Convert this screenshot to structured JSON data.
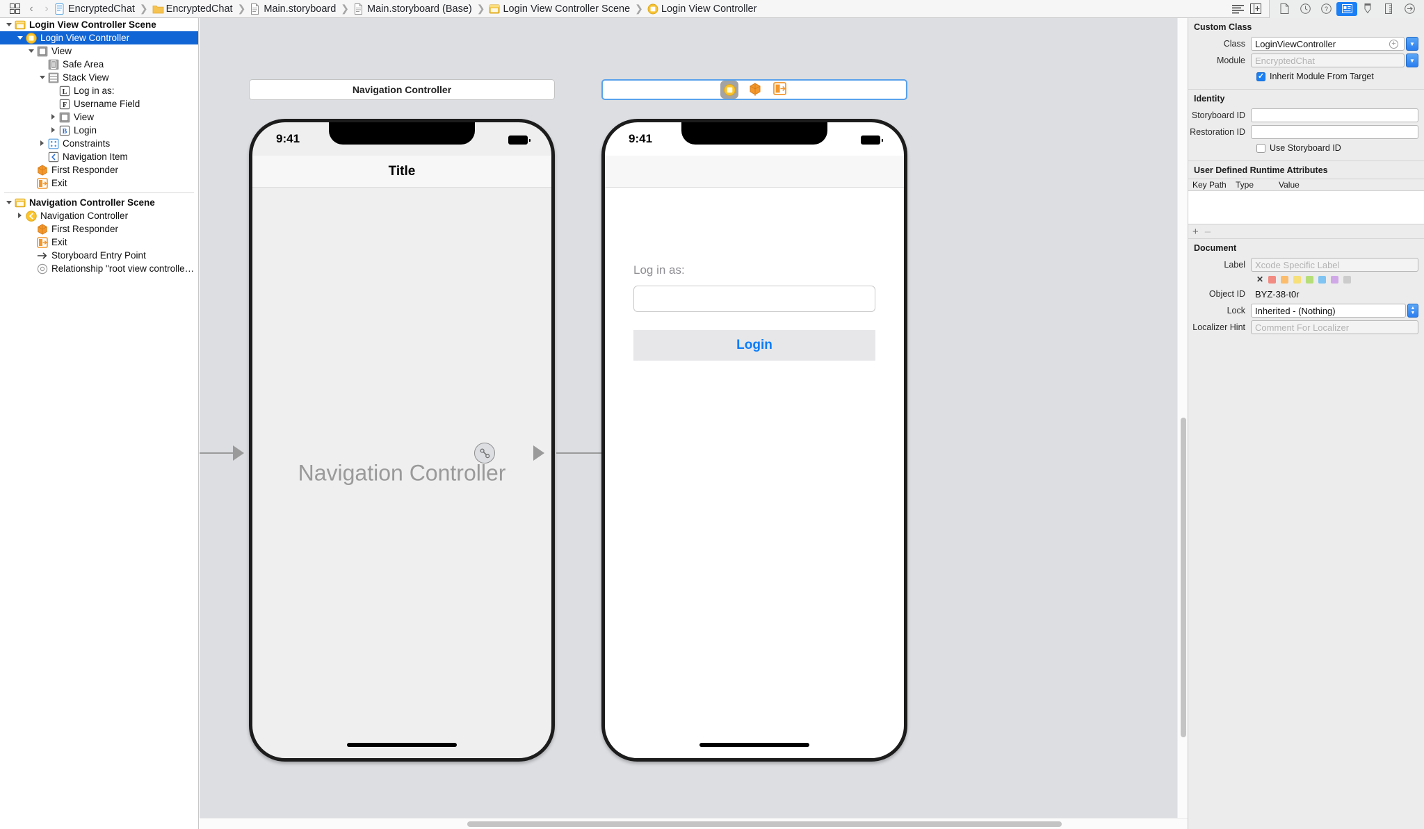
{
  "topbar": {
    "grid_icon": "grid-icon",
    "back_label": "‹",
    "forward_label": "›",
    "breadcrumbs": [
      {
        "label": "EncryptedChat",
        "icon": "project-icon"
      },
      {
        "label": "EncryptedChat",
        "icon": "folder-icon"
      },
      {
        "label": "Main.storyboard",
        "icon": "storyboard-file-icon"
      },
      {
        "label": "Main.storyboard (Base)",
        "icon": "storyboard-file-icon"
      },
      {
        "label": "Login View Controller Scene",
        "icon": "scene-icon"
      },
      {
        "label": "Login View Controller",
        "icon": "view-controller-icon"
      }
    ],
    "editor_buttons": [
      {
        "name": "standard-editor-button"
      },
      {
        "name": "assistant-editor-button"
      }
    ],
    "inspector_buttons": [
      {
        "name": "file-inspector-button",
        "icon": "document-icon",
        "active": false
      },
      {
        "name": "quick-help-inspector-button",
        "icon": "clock-icon",
        "active": false
      },
      {
        "name": "help-inspector-button",
        "icon": "question-icon",
        "active": false
      },
      {
        "name": "identity-inspector-button",
        "icon": "identity-card-icon",
        "active": true
      },
      {
        "name": "attributes-inspector-button",
        "icon": "slider-down-icon",
        "active": false
      },
      {
        "name": "size-inspector-button",
        "icon": "ruler-icon",
        "active": false
      },
      {
        "name": "connections-inspector-button",
        "icon": "arrow-circle-icon",
        "active": false
      }
    ]
  },
  "outline": {
    "groups": [
      {
        "name": "login-view-controller-scene",
        "rows": [
          {
            "label": "Login View Controller Scene",
            "indent": 0,
            "twisty": "open",
            "icon": "scene-icon",
            "bold": true,
            "selected": false
          },
          {
            "label": "Login View Controller",
            "indent": 1,
            "twisty": "open",
            "icon": "view-controller-icon",
            "bold": false,
            "selected": true
          },
          {
            "label": "View",
            "indent": 2,
            "twisty": "open",
            "icon": "view-icon",
            "bold": false,
            "selected": false
          },
          {
            "label": "Safe Area",
            "indent": 3,
            "twisty": "none",
            "icon": "safe-area-icon",
            "bold": false,
            "selected": false
          },
          {
            "label": "Stack View",
            "indent": 3,
            "twisty": "open",
            "icon": "stack-view-icon",
            "bold": false,
            "selected": false
          },
          {
            "label": "Log in as:",
            "indent": 4,
            "twisty": "none",
            "icon": "label-icon",
            "bold": false,
            "selected": false
          },
          {
            "label": "Username Field",
            "indent": 4,
            "twisty": "none",
            "icon": "textfield-icon",
            "bold": false,
            "selected": false
          },
          {
            "label": "View",
            "indent": 4,
            "twisty": "closed",
            "icon": "view-icon",
            "bold": false,
            "selected": false
          },
          {
            "label": "Login",
            "indent": 4,
            "twisty": "closed",
            "icon": "button-icon",
            "bold": false,
            "selected": false
          },
          {
            "label": "Constraints",
            "indent": 3,
            "twisty": "closed",
            "icon": "constraints-icon",
            "bold": false,
            "selected": false
          },
          {
            "label": "Navigation Item",
            "indent": 3,
            "twisty": "none",
            "icon": "navigation-item-icon",
            "bold": false,
            "selected": false
          },
          {
            "label": "First Responder",
            "indent": 2,
            "twisty": "none",
            "icon": "first-responder-icon",
            "bold": false,
            "selected": false
          },
          {
            "label": "Exit",
            "indent": 2,
            "twisty": "none",
            "icon": "exit-icon",
            "bold": false,
            "selected": false
          }
        ]
      },
      {
        "name": "navigation-controller-scene",
        "rows": [
          {
            "label": "Navigation Controller Scene",
            "indent": 0,
            "twisty": "open",
            "icon": "scene-icon",
            "bold": true,
            "selected": false
          },
          {
            "label": "Navigation Controller",
            "indent": 1,
            "twisty": "closed",
            "icon": "navigation-controller-icon",
            "bold": false,
            "selected": false
          },
          {
            "label": "First Responder",
            "indent": 2,
            "twisty": "none",
            "icon": "first-responder-icon",
            "bold": false,
            "selected": false
          },
          {
            "label": "Exit",
            "indent": 2,
            "twisty": "none",
            "icon": "exit-icon",
            "bold": false,
            "selected": false
          },
          {
            "label": "Storyboard Entry Point",
            "indent": 2,
            "twisty": "none",
            "icon": "entry-point-arrow-icon",
            "bold": false,
            "selected": false
          },
          {
            "label": "Relationship \"root view controller\"...",
            "indent": 2,
            "twisty": "none",
            "icon": "relationship-icon",
            "bold": false,
            "selected": false
          }
        ]
      }
    ]
  },
  "canvas": {
    "scene_nav": {
      "bar_label": "Navigation Controller",
      "placeholder_label": "Navigation Controller",
      "status_time": "9:41",
      "nav_title": "Title"
    },
    "scene_login": {
      "status_time": "9:41",
      "objects": [
        {
          "name": "view-controller-object",
          "icon": "view-controller-icon",
          "selected": true
        },
        {
          "name": "first-responder-object",
          "icon": "first-responder-icon",
          "selected": false
        },
        {
          "name": "exit-object",
          "icon": "exit-icon",
          "selected": false
        }
      ],
      "form": {
        "label": "Log in as:",
        "field_value": "",
        "button_label": "Login"
      }
    },
    "segue": {
      "name": "show-segue-badge",
      "icon": "segue-show-icon"
    }
  },
  "inspector": {
    "custom_class": {
      "title": "Custom Class",
      "class_label": "Class",
      "class_value": "LoginViewController",
      "module_label": "Module",
      "module_placeholder": "EncryptedChat",
      "inherit_label": "Inherit Module From Target",
      "inherit_checked": true
    },
    "identity": {
      "title": "Identity",
      "storyboard_id_label": "Storyboard ID",
      "storyboard_id_value": "",
      "restoration_id_label": "Restoration ID",
      "restoration_id_value": "",
      "use_storyboard_id_label": "Use Storyboard ID",
      "use_storyboard_id_checked": false
    },
    "udra": {
      "title": "User Defined Runtime Attributes",
      "columns": [
        "Key Path",
        "Type",
        "Value"
      ],
      "rows": [],
      "add_label": "+",
      "remove_label": "–"
    },
    "document": {
      "title": "Document",
      "label_label": "Label",
      "label_placeholder": "Xcode Specific Label",
      "swatches": [
        "none",
        "#f28b82",
        "#fbbc6b",
        "#f7e07a",
        "#b6de78",
        "#7fc4f2",
        "#d0a8e8",
        "#cccccc"
      ],
      "object_id_label": "Object ID",
      "object_id_value": "BYZ-38-t0r",
      "lock_label": "Lock",
      "lock_value": "Inherited - (Nothing)",
      "localizer_hint_label": "Localizer Hint",
      "localizer_hint_placeholder": "Comment For Localizer"
    }
  },
  "colors": {
    "selection_blue": "#1265d4",
    "accent_blue": "#1a7ef4",
    "link_blue": "#0a7cfb",
    "canvas_bg": "#dcdee2",
    "xcode_orange": "#f3982d",
    "xcode_yellow": "#f8c332"
  }
}
